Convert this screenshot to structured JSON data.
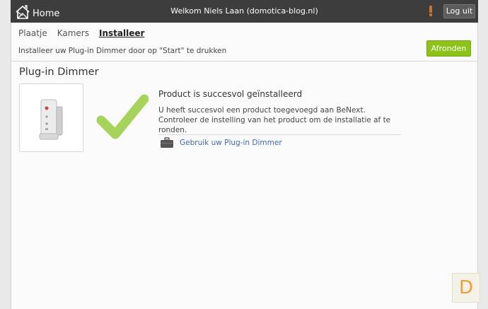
{
  "header": {
    "home_label": "Home",
    "welcome_text": "Welkom Niels Laan (domotica-blog.nl)",
    "logout_label": "Log uit"
  },
  "tabs": [
    {
      "label": "Plaatje"
    },
    {
      "label": "Kamers"
    },
    {
      "label": "Installeer",
      "active": true
    }
  ],
  "instruction": "Installeer uw Plug-in Dimmer door op \"Start\" te drukken",
  "finish_label": "Afronden",
  "page_title": "Plug-in Dimmer",
  "success": {
    "title": "Product is succesvol geïnstalleerd",
    "text": "U heeft succesvol een product toegevoegd aan BeNext. Controleer de instelling van het product om de installatie af te ronden.",
    "link_label": "Gebruik uw Plug-in Dimmer"
  },
  "corner_badge": "D",
  "colors": {
    "topbar": "#3d3d3d",
    "accent_green": "#8cc21a",
    "check_green": "#a6d45a",
    "link_blue": "#3f6ba3",
    "alert_orange": "#c8732e"
  },
  "icons": {
    "home": "house-outline-icon",
    "alert": "exclamation-icon",
    "success": "checkmark-icon",
    "link": "briefcase-icon"
  }
}
